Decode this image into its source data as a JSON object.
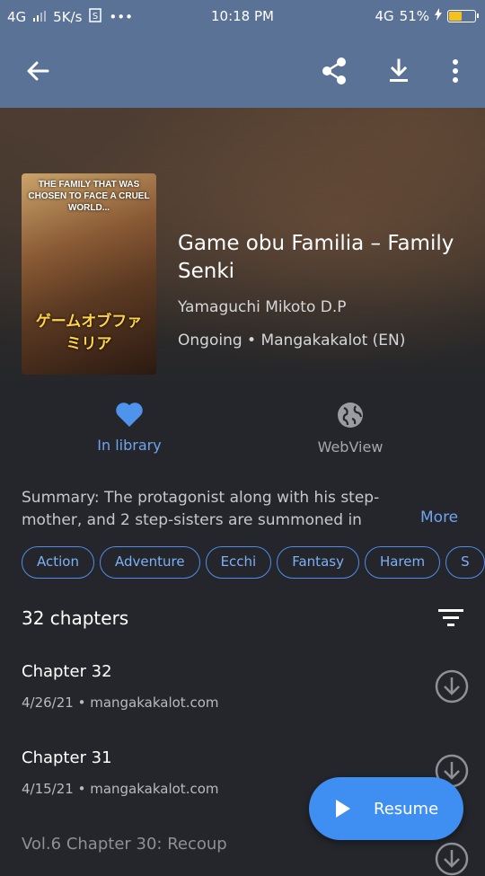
{
  "status_bar": {
    "network": "4G",
    "speed": "5K/s",
    "dots": "•••",
    "time": "10:18 PM",
    "network_right": "4G",
    "battery": "51%",
    "battery_level": 0.51
  },
  "manga": {
    "title": "Game obu Familia – Family Senki",
    "author": "Yamaguchi Mikoto D.P",
    "status_source": "Ongoing • Mangakakalot (EN)",
    "cover_text": "THE FAMILY THAT WAS CHOSEN TO FACE A CRUEL WORLD...",
    "cover_logo": "ゲームオブファミリア"
  },
  "actions": {
    "library_label": "In library",
    "webview_label": "WebView"
  },
  "summary": {
    "text": "Summary: The protagonist along with his step-mother, and 2 step-sisters are summoned in",
    "more_label": "More"
  },
  "genres": [
    "Action",
    "Adventure",
    "Ecchi",
    "Fantasy",
    "Harem",
    "S"
  ],
  "chapters_header": "32 chapters",
  "chapters": [
    {
      "name": "Chapter 32",
      "meta": "4/26/21 • mangakakalot.com"
    },
    {
      "name": "Chapter 31",
      "meta": "4/15/21 • mangakakalot.com"
    },
    {
      "name": "Vol.6 Chapter 30: Recoup",
      "meta": ""
    }
  ],
  "resume_label": "Resume",
  "colors": {
    "app_bar": "#5a7296",
    "accent": "#3f8ef2",
    "background": "#24262b",
    "battery": "#f4c21b"
  }
}
